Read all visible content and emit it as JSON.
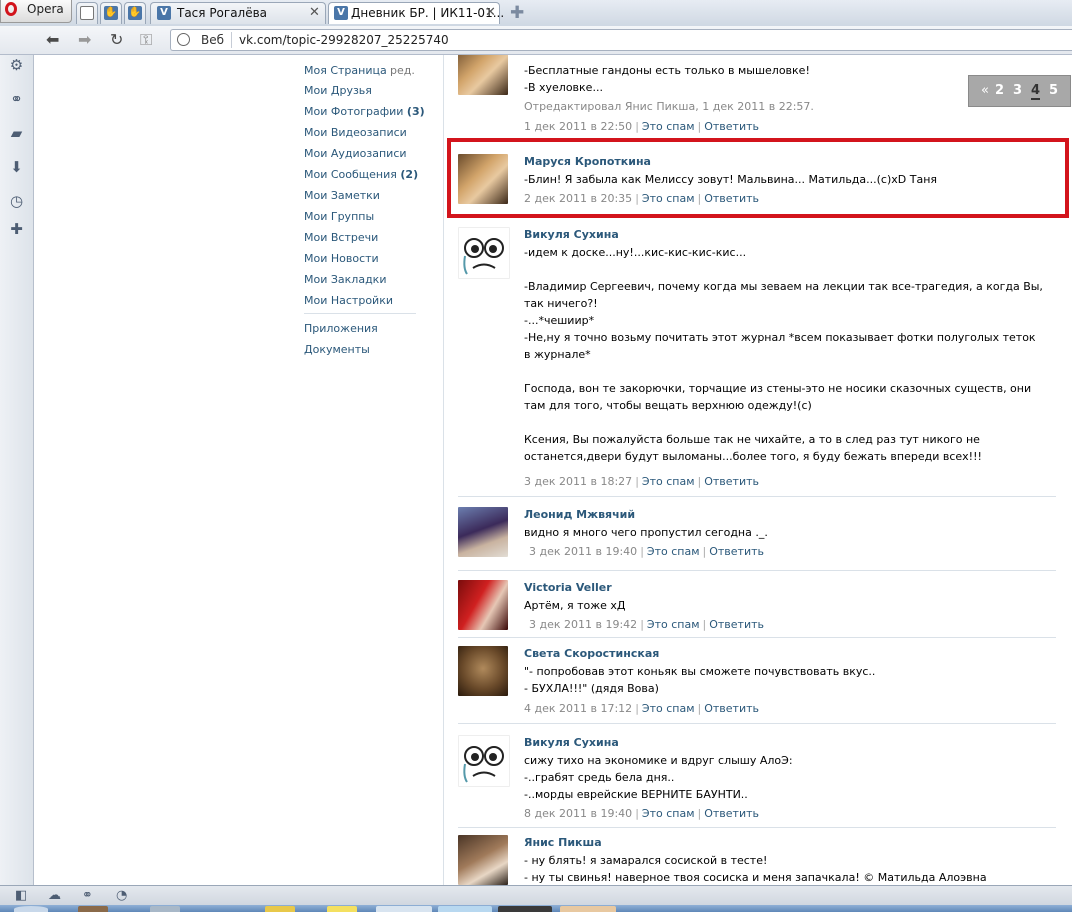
{
  "browser": {
    "menu_label": "Opera",
    "tabs": [
      {
        "title": ""
      },
      {
        "title": ""
      },
      {
        "title": "Тася Рогалёва"
      },
      {
        "title": "Дневник БР. | ИК11-01..."
      }
    ],
    "web_label": "Веб",
    "url": "vk.com/topic-29928207_25225740"
  },
  "sidebar": {
    "edit_label": "ред.",
    "items": [
      {
        "label": "Моя Страница"
      },
      {
        "label": "Мои Друзья"
      },
      {
        "label": "Мои Фотографии",
        "count": "(3)"
      },
      {
        "label": "Мои Видеозаписи"
      },
      {
        "label": "Мои Аудиозаписи"
      },
      {
        "label": "Мои Сообщения",
        "count": "(2)"
      },
      {
        "label": "Мои Заметки"
      },
      {
        "label": "Мои Группы"
      },
      {
        "label": "Мои Встречи"
      },
      {
        "label": "Мои Новости"
      },
      {
        "label": "Мои Закладки"
      },
      {
        "label": "Мои Настройки"
      }
    ],
    "extra": [
      {
        "label": "Приложения"
      },
      {
        "label": "Документы"
      }
    ]
  },
  "pager": {
    "prev": "«",
    "pages": [
      "2",
      "3",
      "4",
      "5"
    ],
    "current": "4"
  },
  "actions": {
    "spam": "Это спам",
    "reply": "Ответить",
    "sep": "|"
  },
  "posts": [
    {
      "name": "",
      "text": "-Бесплатные гандоны есть только в мышеловке!\n-В хуеловке...",
      "edited": "Отредактировал Янис Пикша, 1 дек 2011 в 22:57.",
      "date": "1 дек 2011 в 22:50"
    },
    {
      "name": "Маруся Кропоткина",
      "text": "-Блин! Я забыла как Мелиссу зовут! Мальвина... Матильда...(с)хD Таня",
      "date": "2 дек 2011 в 20:35"
    },
    {
      "name": "Викуля Сухина",
      "text": "-идем к доске...ну!...кис-кис-кис-кис...\n\n-Владимир Сергеевич, почему когда мы зеваем на лекции так все-трагедия, а когда Вы, так ничего?!\n-...*чешиир*\n-Не,ну я точно возьму почитать этот журнал *всем показывает фотки полуголых теток в журнале*\n\nГоспода, вон те закорючки, торчащие из стены-это не носики сказочных существ, они там для того, чтобы вещать верхнюю одежду!(с)\n\nКсения, Вы пожалуйста больше так не чихайте, а то в след раз тут никого не останется,двери будут выломаны...более того, я буду бежать впереди всех!!!",
      "date": "3 дек 2011 в 18:27"
    },
    {
      "name": "Леонид Мжвячий",
      "text": "видно я много чего пропустил сегодна ._.",
      "date": "3 дек 2011 в 19:40"
    },
    {
      "name": "Victoria Veller",
      "text": "Артём, я тоже хД",
      "date": "3 дек 2011 в 19:42"
    },
    {
      "name": "Света Скоростинская",
      "text": "\"- попробовав этот коньяк вы сможете почувствовать вкус..\n- БУХЛА!!!\" (дядя Вова)",
      "date": "4 дек 2011 в 17:12"
    },
    {
      "name": "Викуля Сухина",
      "text": "сижу тихо на экономике и вдруг слышу АлоЭ:\n-..грабят средь бела дня..\n-..морды еврейские ВЕРНИТЕ БАУНТИ..",
      "date": "8 дек 2011 в 19:40"
    },
    {
      "name": "Янис Пикша",
      "text": "- ну блять! я замарался сосиской в тесте!\n- ну ты свинья! наверное твоя сосиска и меня запачкала! © Матильда Алоэвна",
      "date": ""
    }
  ],
  "colors": {
    "link": "#2b587a",
    "highlight": "#d3141c",
    "meta": "#888888"
  }
}
